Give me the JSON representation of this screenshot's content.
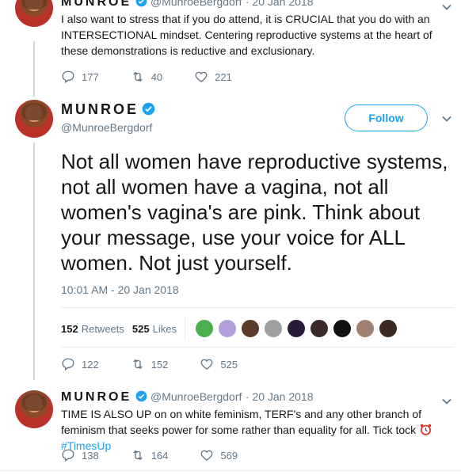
{
  "tweet1": {
    "name": "MUNROE",
    "handle": "@MunroeBergdorf",
    "date": "· 20 Jan 2018",
    "text": "I also want to stress that if you do attend, it is CRUCIAL that you do with an INTERSECTIONAL mindset. Centering reproductive systems at the heart of these demonstrations is reductive and exclusionary.",
    "replies": "177",
    "retweets": "40",
    "likes": "221"
  },
  "main_tweet": {
    "name": "MUNROE",
    "handle": "@MunroeBergdorf",
    "follow_label": "Follow",
    "text": "Not all women have reproductive systems, not all women have a vagina, not all women's vagina's are pink. Think about your message, use your voice for ALL women. Not just yourself.",
    "timestamp": "10:01 AM - 20 Jan 2018",
    "retweet_count": "152",
    "retweet_label": "Retweets",
    "like_count": "525",
    "like_label": "Likes",
    "replies": "122",
    "retweets": "152",
    "likes": "525"
  },
  "tweet3": {
    "name": "MUNROE",
    "handle": "@MunroeBergdorf",
    "date": "· 20 Jan 2018",
    "text": "TIME IS ALSO UP on on white feminism, TERF's and any other branch of feminism that seeks power for some rather than equality for all. Tick tock",
    "hashtag": "#TimesUp",
    "replies": "138",
    "retweets": "164",
    "likes": "569"
  },
  "colors": {
    "accent": "#1da1f2",
    "muted": "#657786",
    "text": "#14171a"
  },
  "liker_avatar_colors": [
    "#4caf50",
    "#b39ddb",
    "#5d3a2a",
    "#9e9e9e",
    "#2a1a3a",
    "#3a2a2a",
    "#111111",
    "#a08070",
    "#3a2a20"
  ]
}
